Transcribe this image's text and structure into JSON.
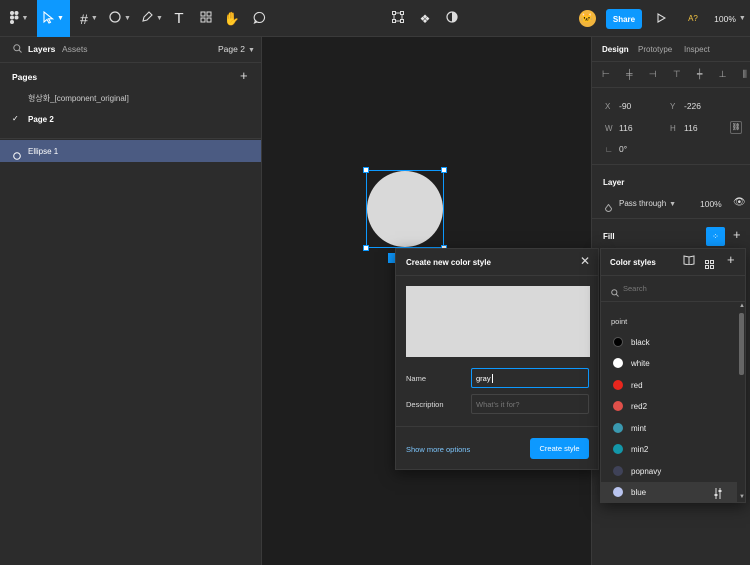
{
  "toolbar": {
    "share_label": "Share",
    "a11y_label": "A?",
    "zoom_label": "100%"
  },
  "left_panel": {
    "tabs": [
      "Layers",
      "Assets"
    ],
    "page_selector": "Page 2",
    "pages_heading": "Pages",
    "pages": [
      "형상화_[component_original]",
      "Page 2"
    ],
    "layers": [
      "Ellipse 1"
    ]
  },
  "right_panel": {
    "tabs": [
      "Design",
      "Prototype",
      "Inspect"
    ],
    "x_label": "X",
    "x_value": "-90",
    "y_label": "Y",
    "y_value": "-226",
    "w_label": "W",
    "w_value": "116",
    "h_label": "H",
    "h_value": "116",
    "rotation_value": "0°",
    "layer_heading": "Layer",
    "blend_mode": "Pass through",
    "opacity": "100%",
    "fill_heading": "Fill"
  },
  "dialog": {
    "title": "Create new color style",
    "preview_color": "#d9d9d9",
    "name_label": "Name",
    "name_value": "gray",
    "description_label": "Description",
    "description_placeholder": "What's it for?",
    "more_options": "Show more options",
    "create_button": "Create style"
  },
  "color_styles": {
    "title": "Color styles",
    "search_placeholder": "Search",
    "group": "point",
    "items": [
      {
        "name": "black",
        "color": "#000000"
      },
      {
        "name": "white",
        "color": "#ffffff"
      },
      {
        "name": "red",
        "color": "#e8261d"
      },
      {
        "name": "red2",
        "color": "#e0504a"
      },
      {
        "name": "mint",
        "color": "#3a99b0"
      },
      {
        "name": "min2",
        "color": "#1397a9"
      },
      {
        "name": "popnavy",
        "color": "#3f4258"
      },
      {
        "name": "blue",
        "color": "#b9c4ef"
      }
    ]
  },
  "colors": {
    "accent": "#0d99ff",
    "selection_row": "#4b5b82"
  }
}
